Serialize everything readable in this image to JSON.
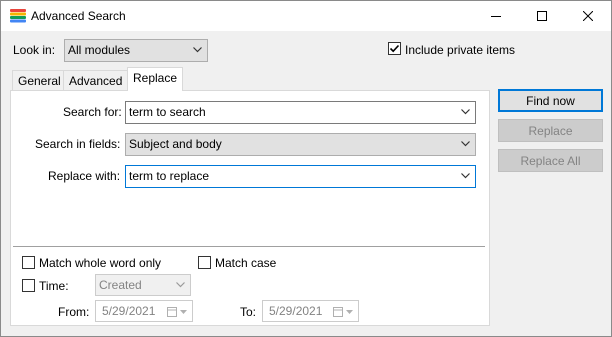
{
  "window": {
    "title": "Advanced Search",
    "icon": "app-stripes-icon",
    "controls": [
      "minimize-icon",
      "maximize-icon",
      "close-icon"
    ]
  },
  "look_in": {
    "label": "Look in:",
    "value": "All modules"
  },
  "include_private": {
    "label": "Include private items",
    "checked": true
  },
  "tabs": [
    {
      "label": "General",
      "active": false
    },
    {
      "label": "Advanced",
      "active": false
    },
    {
      "label": "Replace",
      "active": true
    }
  ],
  "replace_tab": {
    "search_for": {
      "label": "Search for:",
      "value": "term to search"
    },
    "search_in_fields": {
      "label": "Search in fields:",
      "value": "Subject and body"
    },
    "replace_with": {
      "label": "Replace with:",
      "value": "term to replace"
    }
  },
  "options": {
    "match_whole_word": {
      "label": "Match whole word only",
      "checked": false
    },
    "match_case": {
      "label": "Match case",
      "checked": false
    },
    "time": {
      "label": "Time:",
      "checked": false,
      "value": "Created"
    },
    "from": {
      "label": "From:",
      "value": "5/29/2021"
    },
    "to": {
      "label": "To:",
      "value": "5/29/2021"
    }
  },
  "buttons": {
    "find_now": "Find now",
    "replace": "Replace",
    "replace_all": "Replace All"
  },
  "colors": {
    "accent": "#0078d7",
    "disabled_text": "#838383"
  }
}
